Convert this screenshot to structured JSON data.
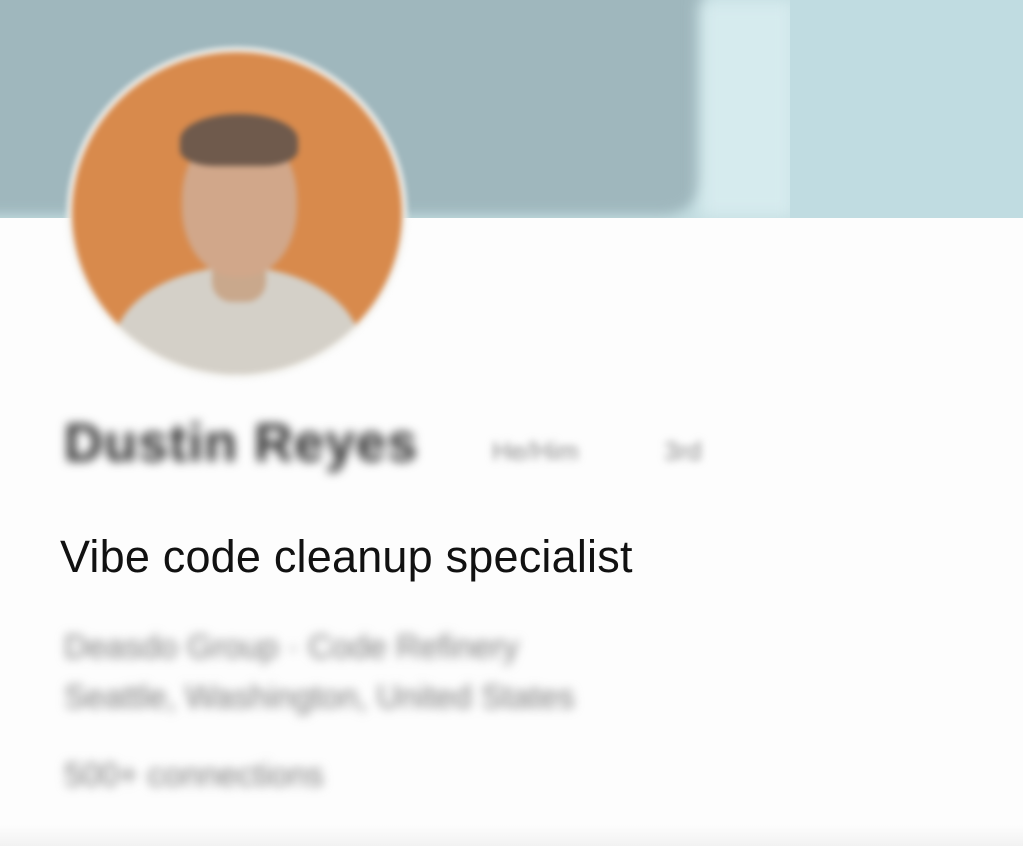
{
  "profile": {
    "name": "Dustin Reyes",
    "pronouns": "He/Him",
    "degree": "3rd",
    "headline": "Vibe code cleanup specialist",
    "company_line": "Deasdo Group · Code Refinery",
    "location": "Seattle, Washington, United States",
    "connections": "500+ connections"
  },
  "colors": {
    "cover_dark": "#9fb7bd",
    "cover_light": "#c3dde1",
    "avatar_bg": "#d88a4c"
  }
}
